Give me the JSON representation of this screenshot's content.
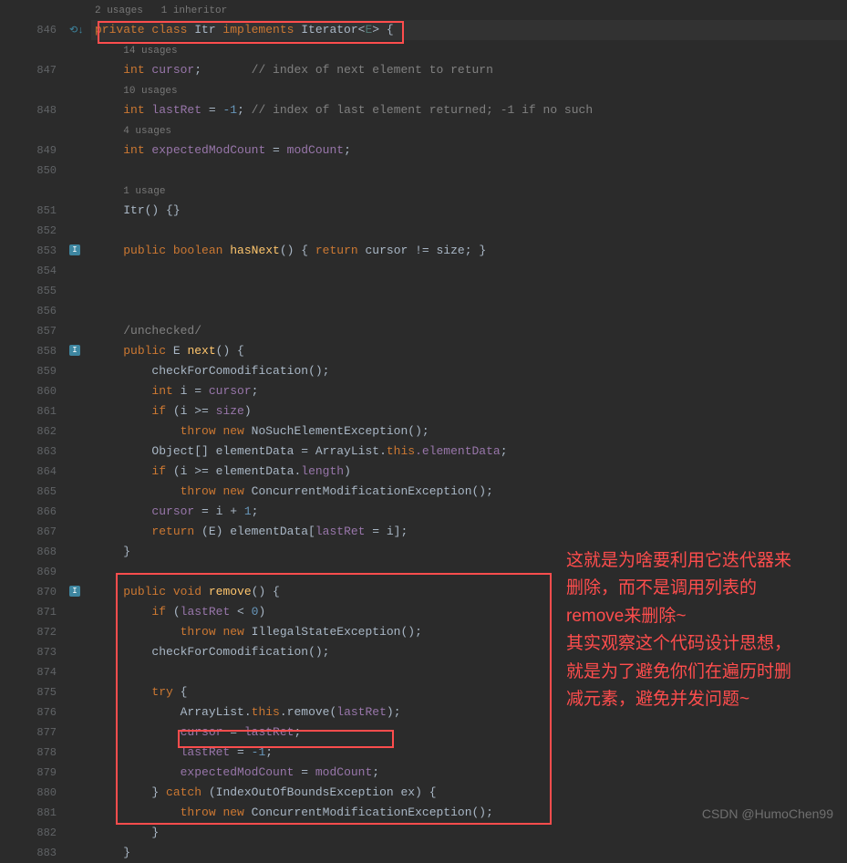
{
  "gutter": {
    "start": 846,
    "end": 883
  },
  "hints": {
    "l0": "2 usages   1 inheritor",
    "l2": "14 usages",
    "l4": "10 usages",
    "l6": "4 usages",
    "l9": "1 usage"
  },
  "code": {
    "l1_priv": "private",
    "l1_class": " class ",
    "l1_itr": "Itr",
    "l1_impl": " implements ",
    "l1_iter": "Iterator",
    "l1_open": "<",
    "l1_e": "E",
    "l1_close": "> ",
    "l1_brace": "{",
    "l3_int": "int",
    "l3_cursor": " cursor",
    "l3_semi": ";       ",
    "l3_comment": "// index of next element to return",
    "l5_int": "int",
    "l5_lastret": " lastRet",
    "l5_eq": " = ",
    "l5_val": "-1",
    "l5_semi": "; ",
    "l5_comment": "// index of last element returned; -1 if no such",
    "l7_int": "int",
    "l7_emc": " expectedModCount",
    "l7_eq": " = ",
    "l7_mc": "modCount",
    "l7_semi": ";",
    "l10_itr": "Itr",
    "l10_paren": "() ",
    "l10_braces": "{}",
    "l12_pub": "public",
    "l12_bool": " boolean ",
    "l12_hasnext": "hasNext",
    "l12_paren": "() ",
    "l12_open": "{ ",
    "l12_ret": "return",
    "l12_expr": " cursor != size; ",
    "l12_close": "}",
    "l14_unchecked": "/unchecked/",
    "l15_pub": "public",
    "l15_e": " E ",
    "l15_next": "next",
    "l15_rest": "() {",
    "l16_check": "checkForComodification",
    "l16_rest": "();",
    "l17_int": "int",
    "l17_i": " i = ",
    "l17_cursor": "cursor",
    "l17_semi": ";",
    "l18_if": "if",
    "l18_cond": " (i >= ",
    "l18_size": "size",
    "l18_close": ")",
    "l19_throw": "throw",
    "l19_new": " new ",
    "l19_exc": "NoSuchElementException",
    "l19_rest": "();",
    "l20_obj": "Object[] elementData = ArrayList.",
    "l20_this": "this",
    "l20_ed": ".elementData",
    "l20_semi": ";",
    "l21_if": "if",
    "l21_cond": " (i >= elementData.",
    "l21_len": "length",
    "l21_close": ")",
    "l22_throw": "throw",
    "l22_new": " new ",
    "l22_exc": "ConcurrentModificationException",
    "l22_rest": "();",
    "l23_cursor": "cursor",
    "l23_eq": " = i + ",
    "l23_one": "1",
    "l23_semi": ";",
    "l24_ret": "return",
    "l24_cast": " (E) elementData[",
    "l24_lr": "lastRet",
    "l24_eq": " = i];",
    "l25_brace": "}",
    "l27_pub": "public",
    "l27_void": " void ",
    "l27_remove": "remove",
    "l27_rest": "() {",
    "l28_if": "if",
    "l28_open": " (",
    "l28_lr": "lastRet",
    "l28_lt": " < ",
    "l28_zero": "0",
    "l28_close": ")",
    "l29_throw": "throw",
    "l29_new": " new ",
    "l29_exc": "IllegalStateException",
    "l29_rest": "();",
    "l30_check": "checkForComodification",
    "l30_rest": "();",
    "l32_try": "try",
    "l32_brace": " {",
    "l33_al": "ArrayList.",
    "l33_this": "this",
    "l33_rem": ".remove(",
    "l33_lr": "lastRet",
    "l33_close": ");",
    "l34_cursor": "cursor",
    "l34_eq": " = ",
    "l34_lr": "lastRet",
    "l34_semi": ";",
    "l35_lr": "lastRet",
    "l35_eq": " = ",
    "l35_val": "-1",
    "l35_semi": ";",
    "l36_emc": "expectedModCount",
    "l36_eq": " = ",
    "l36_mc": "modCount",
    "l36_semi": ";",
    "l37_close": "} ",
    "l37_catch": "catch",
    "l37_cond": " (IndexOutOfBoundsException ex) {",
    "l38_throw": "throw",
    "l38_new": " new ",
    "l38_exc": "ConcurrentModificationException",
    "l38_rest": "();",
    "l39_brace": "}",
    "l40_brace": "}"
  },
  "annotations": {
    "comment1": "这就是为啥要利用它迭代器来",
    "comment2": "删除，而不是调用列表的",
    "comment3": "remove来删除~",
    "comment4": "其实观察这个代码设计思想，",
    "comment5": "就是为了避免你们在遍历时删",
    "comment6": "减元素，避免并发问题~"
  },
  "watermark": "CSDN @HumoChen99"
}
